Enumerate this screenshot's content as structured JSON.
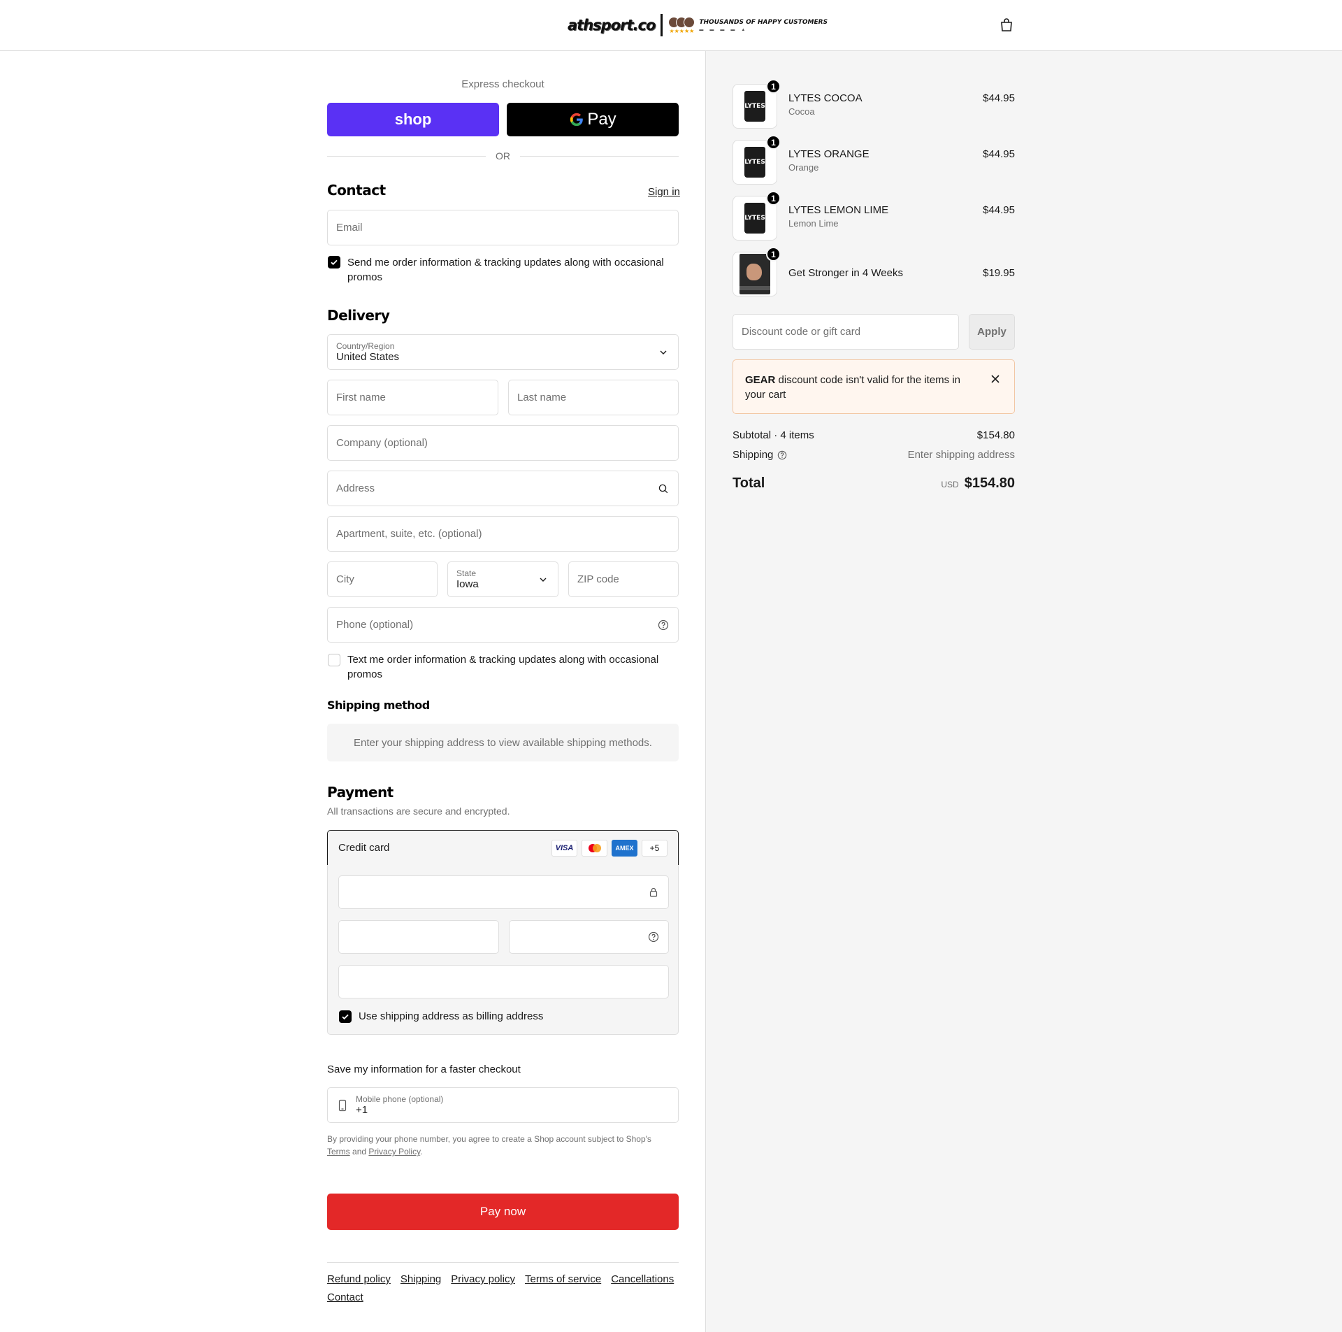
{
  "header": {
    "logo_word": "athsport.co",
    "logo_tagline": "THOUSANDS OF HAPPY CUSTOMERS",
    "logo_stars": "★★★★★",
    "cart_icon": "shopping-bag-icon"
  },
  "express": {
    "label": "Express checkout",
    "shop_label": "shop",
    "gpay_label": "Pay",
    "or_label": "OR"
  },
  "contact": {
    "title": "Contact",
    "sign_in": "Sign in",
    "email_placeholder": "Email",
    "email_optin": "Send me order information & tracking updates along with occasional promos",
    "email_optin_checked": true
  },
  "delivery": {
    "title": "Delivery",
    "country_label": "Country/Region",
    "country_value": "United States",
    "first_name": "First name",
    "last_name": "Last name",
    "company": "Company (optional)",
    "address": "Address",
    "apartment": "Apartment, suite, etc. (optional)",
    "city": "City",
    "state_label": "State",
    "state_value": "Iowa",
    "zip": "ZIP code",
    "phone": "Phone (optional)",
    "sms_optin": "Text me order information & tracking updates along with occasional promos",
    "sms_optin_checked": false
  },
  "shipping_method": {
    "title": "Shipping method",
    "info": "Enter your shipping address to view available shipping methods."
  },
  "payment": {
    "title": "Payment",
    "subtitle": "All transactions are secure and encrypted.",
    "method": "Credit card",
    "card_logos": [
      "VISA",
      "mastercard",
      "AMEX"
    ],
    "more_cards": "+5",
    "billing_same": "Use shipping address as billing address",
    "billing_same_checked": true
  },
  "save_info": {
    "title": "Save my information for a faster checkout",
    "phone_label": "Mobile phone (optional)",
    "phone_value": "+1",
    "legal_prefix": "By providing your phone number, you agree to create a Shop account subject to Shop's",
    "terms": "Terms",
    "and": "and",
    "privacy": "Privacy Policy",
    "period": "."
  },
  "pay_now": "Pay now",
  "footer_links": [
    "Refund policy",
    "Shipping",
    "Privacy policy",
    "Terms of service",
    "Cancellations",
    "Contact"
  ],
  "cart": {
    "items": [
      {
        "name": "LYTES COCOA",
        "variant": "Cocoa",
        "price": "$44.95",
        "qty": "1",
        "thumb": "LYTES"
      },
      {
        "name": "LYTES ORANGE",
        "variant": "Orange",
        "price": "$44.95",
        "qty": "1",
        "thumb": "LYTES"
      },
      {
        "name": "LYTES LEMON LIME",
        "variant": "Lemon Lime",
        "price": "$44.95",
        "qty": "1",
        "thumb": "LYTES"
      },
      {
        "name": "Get Stronger in 4 Weeks",
        "variant": "",
        "price": "$19.95",
        "qty": "1",
        "thumb": "book"
      }
    ],
    "discount_placeholder": "Discount code or gift card",
    "apply": "Apply",
    "alert_code": "GEAR",
    "alert_text": "discount code isn't valid for the items in your cart",
    "subtotal_label": "Subtotal · 4 items",
    "subtotal_value": "$154.80",
    "shipping_label": "Shipping",
    "shipping_value": "Enter shipping address",
    "total_label": "Total",
    "currency": "USD",
    "total_value": "$154.80"
  },
  "colors": {
    "shop_purple": "#5a31f4",
    "pay_now_red": "#e32828",
    "alert_bg": "#fff6ef"
  }
}
